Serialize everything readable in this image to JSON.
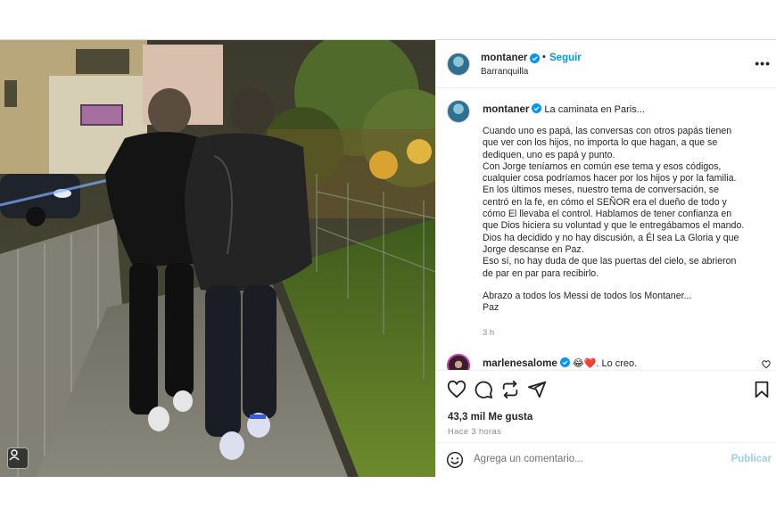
{
  "post": {
    "username": "montaner",
    "follow_label": "Seguir",
    "separator": "•",
    "location": "Barranquilla",
    "more_label": "•••"
  },
  "caption": {
    "username": "montaner",
    "title": "La caminata en Paris...",
    "paragraphs": [
      "Cuando uno es papá, las conversas con otros papás tienen\nque ver con los hijos, no importa lo que hagan, a que se\ndediquen, uno es papá y punto.\nCon Jorge teníamos en común ese tema y esos códigos,\ncualquier cosa podríamos hacer por los hijos y por la familia.\nEn los últimos meses, nuestro tema de conversación, se\ncentró en la fe, en cómo el SEÑOR era el dueño de todo y\ncómo El llevaba el control. Hablamos de tener confianza en\nque Dios hiciera su voluntad y que le entregábamos el mando.\nDios ha decidido y no hay discusión, a Él sea La Gloria y que\nJorge descanse en Paz.\nEso sí, no hay duda de que las puertas del cielo, se abrieron\nde par en par para recibirlo.",
      "Abrazo a todos los Messi de todos los Montaner...\nPaz"
    ],
    "time": "3 h"
  },
  "comment": {
    "username": "marlenesalome",
    "text": "😂❤️. Lo creo."
  },
  "actions": {
    "likes": "43,3 mil Me gusta",
    "ago": "Hace 3 horas",
    "comment_placeholder": "Agrega un comentario...",
    "publish_label": "Publicar"
  },
  "colors": {
    "link_blue": "#0095f6",
    "publish_disabled": "#9ccdf5",
    "verified_blue": "#0095f6",
    "border": "#dbdbdb"
  },
  "icons": [
    "verified-badge-icon",
    "heart-icon",
    "comment-icon",
    "share-icon",
    "send-icon",
    "bookmark-icon",
    "emoji-icon",
    "tag-user-icon",
    "more-options-icon"
  ]
}
